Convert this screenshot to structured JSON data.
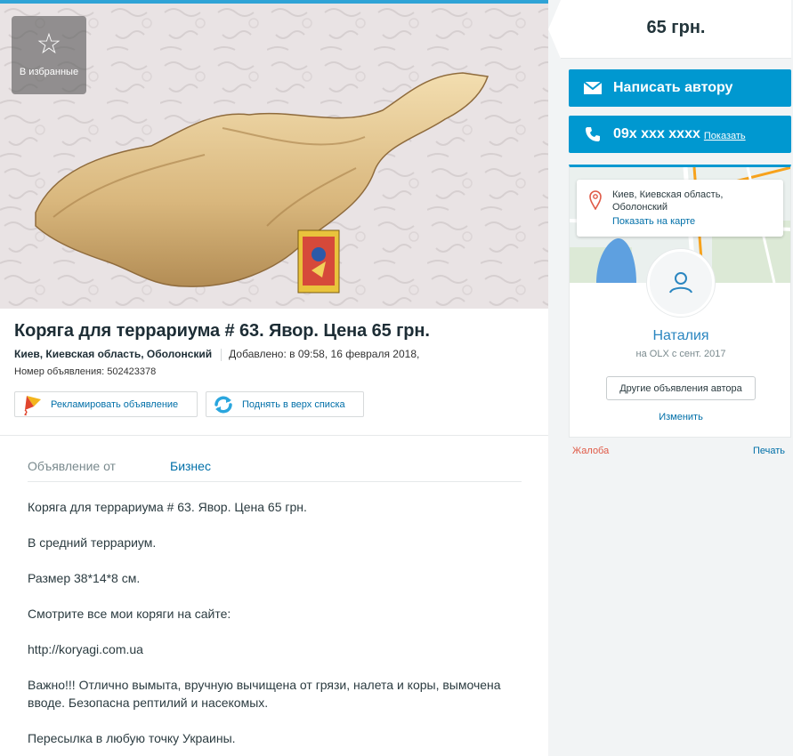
{
  "photo": {
    "favorite_label": "В избранные",
    "star_glyph": "☆",
    "matchbox_text": "",
    "photo_caption": ""
  },
  "listing": {
    "title": "Коряга для террариума # 63. Явор. Цена 65 грн.",
    "location": "Киев, Киевская область, Оболонский",
    "added": "Добавлено: в 09:58, 16 февраля 2018,",
    "number": "Номер объявления: 502423378"
  },
  "actions": {
    "promote_label": "Рекламировать объявление",
    "bump_label": "Поднять в верх списка"
  },
  "attributes": {
    "label": "Объявление от",
    "value": "Бизнес"
  },
  "description": [
    "Коряга для террариума # 63. Явор. Цена 65 грн.",
    "В средний террариум.",
    "Размер 38*14*8 см.",
    "Смотрите все мои коряги на сайте:",
    "http://koryagi.com.ua",
    "Важно!!! Отлично вымыта, вручную вычищена от грязи, налета и коры, вымочена вводе. Безопасна рептилий и насекомых.",
    "Пересылка в любую точку Украины."
  ],
  "sidebar": {
    "price": "65 грн.",
    "message_button": "Написать автору",
    "phone": "09x xxx xxxx",
    "phone_show": "Показать",
    "map_address": "Киев, Киевская область, Оболонский",
    "show_on_map": "Показать на карте",
    "user_name": "Наталия",
    "user_since": "на OLX с сент. 2017",
    "other_ads": "Другие объявления автора",
    "edit": "Изменить",
    "complaint": "Жалоба",
    "print": "Печать"
  },
  "colors": {
    "accent": "#0098d0",
    "link": "#006fa8",
    "complaint": "#e05a47",
    "top_bar": "#2fa3d6"
  }
}
